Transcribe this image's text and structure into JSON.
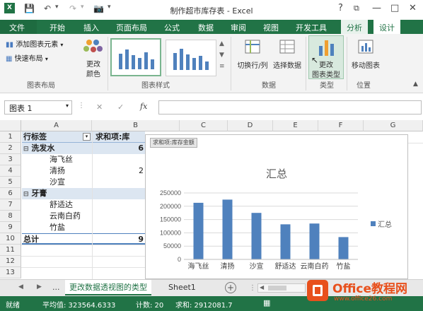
{
  "window": {
    "title": "制作超市库存表 - Excel",
    "help": "?",
    "restore": "⧉",
    "minimize": "—",
    "maximize": "□",
    "close": "✕"
  },
  "tabs": {
    "file": "文件",
    "home": "开始",
    "insert": "插入",
    "page_layout": "页面布局",
    "formulas": "公式",
    "data": "数据",
    "review": "审阅",
    "view": "视图",
    "developer": "开发工具",
    "analyze": "分析",
    "design": "设计"
  },
  "ribbon": {
    "add_element": "添加图表元素",
    "quick_layout": "快速布局",
    "change_colors_1": "更改",
    "change_colors_2": "颜色",
    "group_layout": "图表布局",
    "group_styles": "图表样式",
    "switch_rowcol": "切换行/列",
    "select_data": "选择数据",
    "group_data": "数据",
    "change_type_1": "更改",
    "change_type_2": "图表类型",
    "group_type": "类型",
    "move_chart": "移动图表",
    "group_location": "位置"
  },
  "formula_bar": {
    "name_box": "图表 1",
    "fx": "fx",
    "cancel": "✕",
    "enter": "✓"
  },
  "grid": {
    "columns": [
      "A",
      "B",
      "C",
      "D",
      "E",
      "F",
      "G"
    ],
    "rows": [
      "1",
      "2",
      "3",
      "4",
      "5",
      "6",
      "7",
      "8",
      "9",
      "10",
      "11",
      "12",
      "13"
    ],
    "a1": "行标签",
    "b1": "求和项:库",
    "a2": "洗发水",
    "b2": "6",
    "a3": "海飞丝",
    "a4": "清扬",
    "b4": "2",
    "a5": "沙宣",
    "a6": "牙膏",
    "a7": "舒适达",
    "a8": "云南白药",
    "a9": "竹盐",
    "a10": "总计",
    "b10": "9"
  },
  "chart_data": {
    "type": "bar",
    "field_button": "求和项:库存金额",
    "title": "汇总",
    "categories": [
      "海飞丝",
      "清扬",
      "沙宣",
      "舒适达",
      "云南白药",
      "竹盐"
    ],
    "series": [
      {
        "name": "汇总",
        "values": [
          213000,
          225000,
          175000,
          132000,
          135000,
          84000
        ]
      }
    ],
    "ylim": [
      0,
      250000
    ],
    "yticks": [
      "0",
      "50000",
      "100000",
      "150000",
      "200000",
      "250000"
    ],
    "color": "#4f81bd",
    "grid": true,
    "legend": "right"
  },
  "sheet_tabs": {
    "nav_prev": "◀",
    "nav_next": "▶",
    "more": "...",
    "active": "更改数据透视图的类型",
    "sheet1": "Sheet1",
    "add": "+"
  },
  "status": {
    "ready": "就绪",
    "average": "平均值: 323564.6333",
    "count": "计数: 20",
    "sum": "求和: 2912081.7"
  },
  "watermark": {
    "brand": "Office教程网",
    "url": "www.office26.com"
  }
}
